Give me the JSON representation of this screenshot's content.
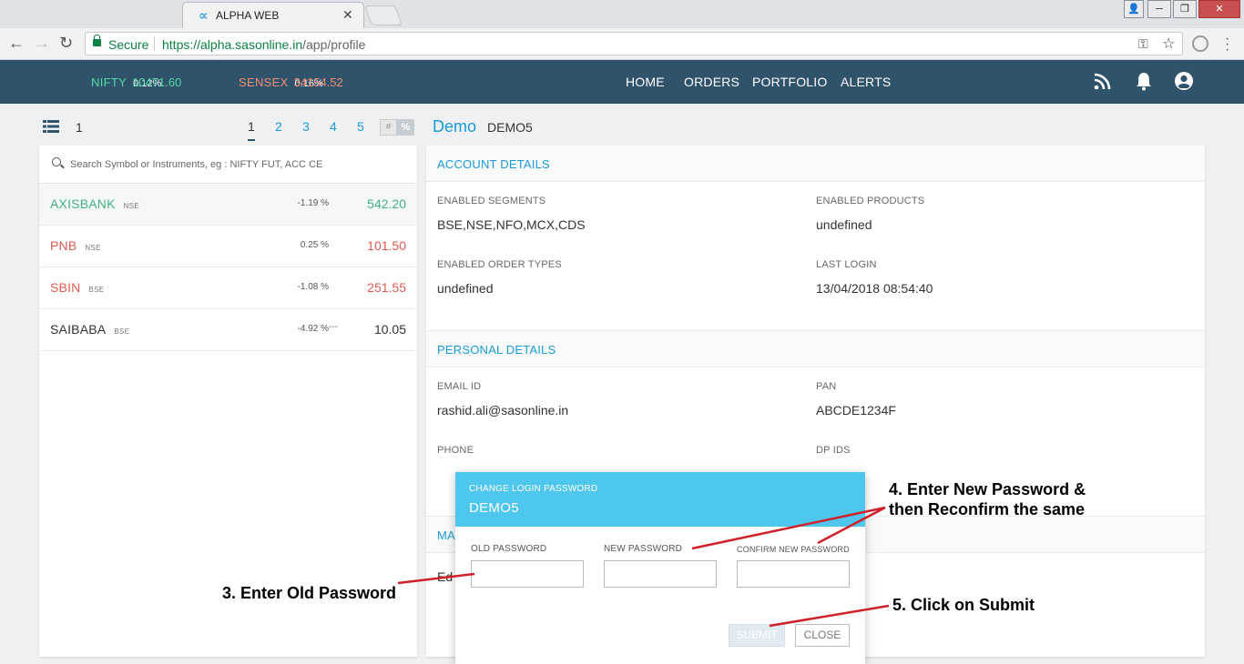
{
  "browser": {
    "tab_title": "ALPHA WEB",
    "tab_favicon": "∝",
    "secure_label": "Secure",
    "url_host": "https://alpha.sasonline.in",
    "url_path": "/app/profile"
  },
  "header": {
    "indices": [
      {
        "name": "NIFTY",
        "value": "10471.60",
        "change": "0.12%",
        "color": "#53d8a4"
      },
      {
        "name": "SENSEX",
        "value": "34154.52",
        "change": "0.16%",
        "color": "#f28c72"
      }
    ],
    "nav": [
      "HOME",
      "ORDERS",
      "PORTFOLIO",
      "ALERTS"
    ],
    "icons": [
      "rss-icon",
      "bell-icon",
      "user-icon"
    ]
  },
  "watchlist": {
    "current": "1",
    "pages": [
      "1",
      "2",
      "3",
      "4",
      "5"
    ],
    "toggle": [
      "#",
      "%"
    ],
    "search_placeholder": "Search Symbol or Instruments, eg : NIFTY FUT, ACC CE",
    "rows": [
      {
        "symbol": "AXISBANK",
        "exchange": "NSE",
        "change": "-1.19 %",
        "price": "542.20",
        "color": "#3fb27f"
      },
      {
        "symbol": "PNB",
        "exchange": "NSE",
        "change": "0.25 %",
        "price": "101.50",
        "color": "#e05a4f"
      },
      {
        "symbol": "SBIN",
        "exchange": "BSE",
        "change": "-1.08 %",
        "price": "251.55",
        "color": "#e05a4f"
      },
      {
        "symbol": "SAIBABA",
        "exchange": "BSE",
        "change": "-4.92 %",
        "extra": "---",
        "price": "10.05",
        "color": "#333333"
      }
    ]
  },
  "profile": {
    "name": "Demo",
    "client_id": "DEMO5",
    "account_details": {
      "title": "ACCOUNT DETAILS",
      "enabled_segments_label": "ENABLED SEGMENTS",
      "enabled_segments": "BSE,NSE,NFO,MCX,CDS",
      "enabled_products_label": "ENABLED PRODUCTS",
      "enabled_products": "undefined",
      "enabled_order_types_label": "ENABLED ORDER TYPES",
      "enabled_order_types": "undefined",
      "last_login_label": "LAST LOGIN",
      "last_login": "13/04/2018 08:54:40"
    },
    "personal_details": {
      "title": "PERSONAL DETAILS",
      "email_label": "EMAIL ID",
      "email": "rashid.ali@sasonline.in",
      "pan_label": "PAN",
      "pan": "ABCDE1234F",
      "phone_label": "PHONE",
      "dp_ids_label": "DP IDS"
    },
    "hidden_section_partial": "MA",
    "hidden_field_partial": "Ed"
  },
  "modal": {
    "title": "CHANGE LOGIN PASSWORD",
    "user": "DEMO5",
    "old_password_label": "OLD PASSWORD",
    "new_password_label": "NEW PASSWORD",
    "confirm_password_label": "CONFIRM NEW PASSWORD",
    "submit_label": "SUBMIT",
    "close_label": "CLOSE"
  },
  "annotations": {
    "step3": "3. Enter Old Password",
    "step4_line1": "4. Enter New Password &",
    "step4_line2": "then Reconfirm the same",
    "step5": "5. Click on Submit",
    "arrow_color": "#d0202a"
  }
}
